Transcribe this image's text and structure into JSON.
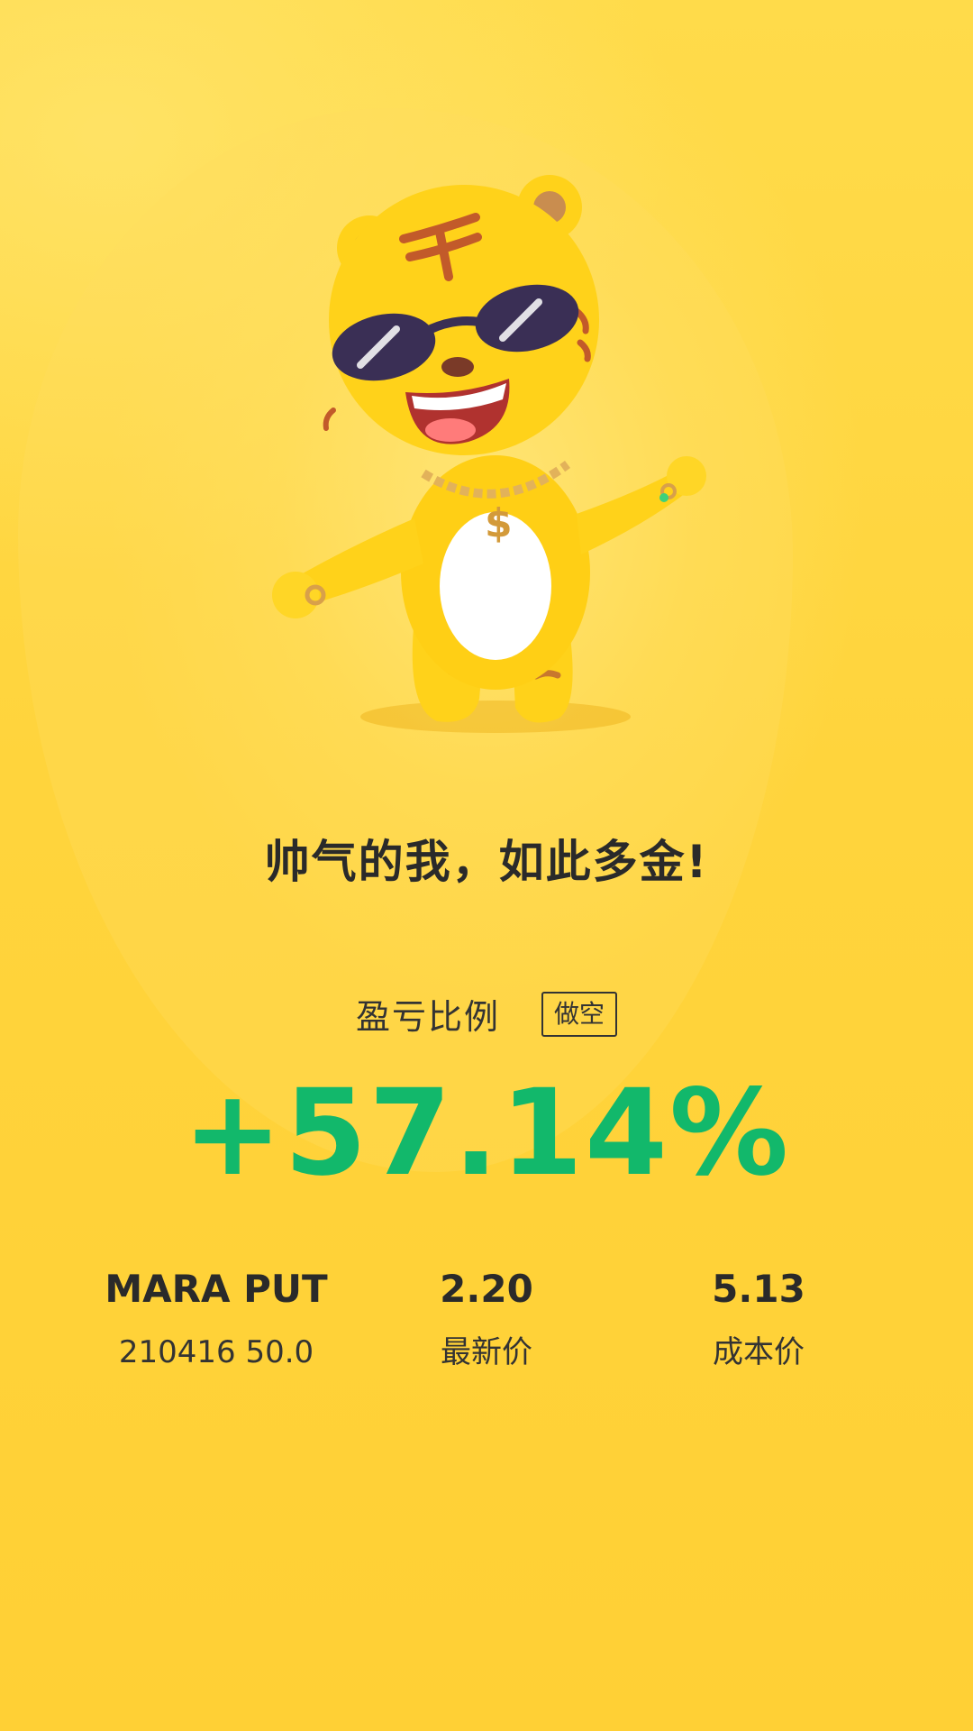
{
  "slogan": "帅气的我，如此多金!",
  "pnl": {
    "label": "盈亏比例",
    "direction_badge": "做空",
    "ratio_value": "+57.14%",
    "ratio_color": "#12b86b"
  },
  "stats": {
    "contract_name": "MARA PUT",
    "contract_detail": "210416 50.0",
    "latest_price": "2.20",
    "latest_price_label": "最新价",
    "cost_price": "5.13",
    "cost_price_label": "成本价"
  },
  "theme": {
    "background": "#ffd53c",
    "text_dark": "#2a2a2a"
  },
  "mascot": {
    "icon": "tiger-mascot-sunglasses-icon"
  }
}
